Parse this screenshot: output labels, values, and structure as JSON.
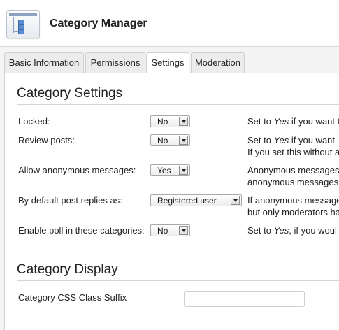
{
  "header": {
    "title": "Category Manager",
    "icon": "category-tree-icon"
  },
  "tabs": [
    {
      "label": "Basic Information",
      "active": false
    },
    {
      "label": "Permissions",
      "active": false
    },
    {
      "label": "Settings",
      "active": true
    },
    {
      "label": "Moderation",
      "active": false
    }
  ],
  "settings": {
    "title": "Category Settings",
    "rows": [
      {
        "label": "Locked:",
        "value": "No",
        "desc": [
          {
            "pre": "Set to ",
            "em": "Yes",
            "post": " if you want t"
          }
        ]
      },
      {
        "label": "Review posts:",
        "value": "No",
        "desc": [
          {
            "pre": "Set to ",
            "em": "Yes",
            "post": " if you want"
          },
          {
            "pre": "If you set this without a",
            "em": "",
            "post": ""
          }
        ]
      },
      {
        "label": "Allow anonymous messages:",
        "value": "Yes",
        "desc": [
          {
            "pre": "Anonymous messages",
            "em": "",
            "post": ""
          },
          {
            "pre": "anonymous messages",
            "em": "",
            "post": ""
          }
        ]
      },
      {
        "label": "By default post replies as:",
        "value": "Registered user",
        "desc": [
          {
            "pre": "If anonymous messages",
            "em": "",
            "post": ""
          },
          {
            "pre": "but only moderators ha",
            "em": "",
            "post": ""
          }
        ]
      },
      {
        "label": "Enable poll in these categories:",
        "value": "No",
        "desc": [
          {
            "pre": "Set to ",
            "em": "Yes",
            "post": ", if you woul"
          }
        ]
      }
    ]
  },
  "display": {
    "title": "Category Display",
    "css_label": "Category CSS Class Suffix",
    "css_value": ""
  }
}
